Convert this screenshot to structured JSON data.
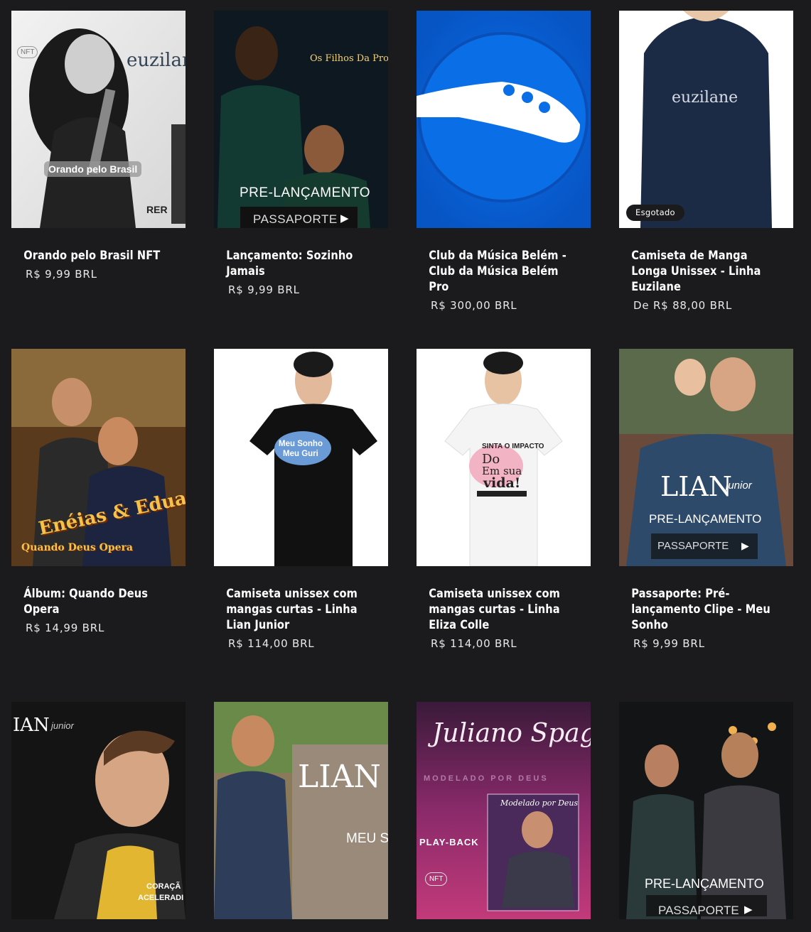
{
  "products": [
    {
      "title": "Orando pelo Brasil NFT",
      "price": "R$ 9,99 BRL",
      "image": {
        "caption": "Orando pelo Brasil",
        "logo": "euzilane",
        "tag": "NFT",
        "corner": "RER"
      }
    },
    {
      "title": "Lançamento: Sozinho Jamais",
      "price": "R$ 9,99 BRL",
      "image": {
        "logo": "Os Filhos Da Promessa",
        "line1": "PRE-LANÇAMENTO",
        "line2": "PASSAPORTE"
      }
    },
    {
      "title": "Club da Música Belém - Club da Música Belém Pro",
      "price": "R$ 300,00 BRL",
      "image": {}
    },
    {
      "title": "Camiseta de Manga Longa Unissex - Linha Euzilane",
      "price": "De R$ 88,00 BRL",
      "badge": "Esgotado",
      "image": {
        "logo": "euzilane"
      }
    },
    {
      "title": "Álbum: Quando Deus Opera",
      "price": "R$ 14,99 BRL",
      "image": {
        "line1": "Enéias & Eduardo",
        "line2": "Quando Deus Opera"
      }
    },
    {
      "title": "Camiseta unissex com mangas curtas - Linha Lian Junior",
      "price": "R$ 114,00 BRL",
      "image": {
        "shirt_text1": "Meu Sonho",
        "shirt_text2": "Meu Guri"
      }
    },
    {
      "title": "Camiseta unissex com mangas curtas - Linha Eliza Colle",
      "price": "R$ 114,00 BRL",
      "image": {
        "shirt_text1": "SINTA O IMPACTO",
        "shirt_text2": "Do",
        "shirt_text3": "Em sua",
        "shirt_text4": "vida!"
      }
    },
    {
      "title": "Passaporte: Pré-lançamento Clipe - Meu Sonho",
      "price": "R$ 9,99 BRL",
      "image": {
        "logo1": "LIAN",
        "logo2": "junior",
        "line1": "PRE-LANÇAMENTO",
        "line2": "PASSAPORTE"
      }
    },
    {
      "title": "",
      "price": "",
      "image": {
        "logo1": "IAN",
        "logo2": "junior",
        "corner1": "CORAÇÃ",
        "corner2": "ACELERADI"
      }
    },
    {
      "title": "",
      "price": "",
      "image": {
        "logo1": "LIAN",
        "corner1": "MEU S"
      }
    },
    {
      "title": "",
      "price": "",
      "image": {
        "logo1": "Juliano Spagnol",
        "logo2": "MODELADO POR DEUS",
        "line1": "PLAY-BACK",
        "tag": "NFT",
        "inner": "Modelado por Deus"
      }
    },
    {
      "title": "",
      "price": "",
      "image": {
        "line1": "PRE-LANÇAMENTO",
        "line2": "PASSAPORTE"
      }
    }
  ],
  "colors": {
    "background": "#1b1b1d",
    "badge_bg": "#1b1b1d",
    "club_blue": "#0a6fe6"
  }
}
